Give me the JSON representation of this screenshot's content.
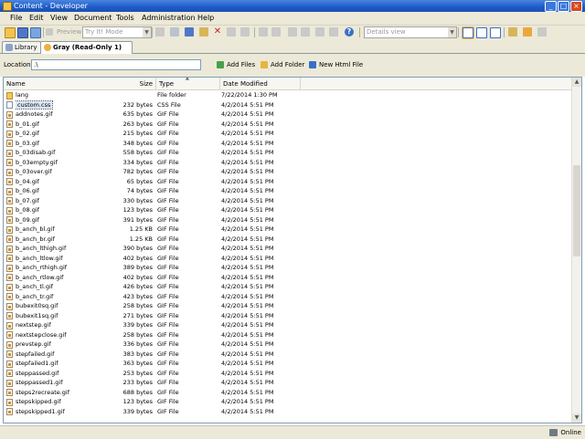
{
  "window": {
    "title": "Content - Developer"
  },
  "menu": [
    "File",
    "Edit",
    "View",
    "Document",
    "Tools",
    "Administration",
    "Help"
  ],
  "toolbar": {
    "preview_label": "Preview",
    "mode_select": "Try It! Mode",
    "view_select": "Details view"
  },
  "tabs": [
    {
      "label": "Library"
    },
    {
      "label": "Gray (Read-Only 1)"
    }
  ],
  "location": {
    "label": "Location:",
    "value": ".\\"
  },
  "actions": {
    "add_files": "Add Files",
    "add_folder": "Add Folder",
    "new_html": "New Html File"
  },
  "columns": {
    "name": "Name",
    "size": "Size",
    "type": "Type",
    "date": "Date Modified"
  },
  "files": [
    {
      "name": "lang",
      "size": "",
      "type": "File folder",
      "date": "7/22/2014 1:30 PM",
      "kind": "folder"
    },
    {
      "name": "custom.css",
      "size": "232 bytes",
      "type": "CSS File",
      "date": "4/2/2014 5:51 PM",
      "kind": "css"
    },
    {
      "name": "addnotes.gif",
      "size": "635 bytes",
      "type": "GIF File",
      "date": "4/2/2014 5:51 PM",
      "kind": "gif"
    },
    {
      "name": "b_01.gif",
      "size": "263 bytes",
      "type": "GIF File",
      "date": "4/2/2014 5:51 PM",
      "kind": "gif"
    },
    {
      "name": "b_02.gif",
      "size": "215 bytes",
      "type": "GIF File",
      "date": "4/2/2014 5:51 PM",
      "kind": "gif"
    },
    {
      "name": "b_03.gif",
      "size": "348 bytes",
      "type": "GIF File",
      "date": "4/2/2014 5:51 PM",
      "kind": "gif"
    },
    {
      "name": "b_03disab.gif",
      "size": "558 bytes",
      "type": "GIF File",
      "date": "4/2/2014 5:51 PM",
      "kind": "gif"
    },
    {
      "name": "b_03empty.gif",
      "size": "334 bytes",
      "type": "GIF File",
      "date": "4/2/2014 5:51 PM",
      "kind": "gif"
    },
    {
      "name": "b_03over.gif",
      "size": "782 bytes",
      "type": "GIF File",
      "date": "4/2/2014 5:51 PM",
      "kind": "gif"
    },
    {
      "name": "b_04.gif",
      "size": "65 bytes",
      "type": "GIF File",
      "date": "4/2/2014 5:51 PM",
      "kind": "gif"
    },
    {
      "name": "b_06.gif",
      "size": "74 bytes",
      "type": "GIF File",
      "date": "4/2/2014 5:51 PM",
      "kind": "gif"
    },
    {
      "name": "b_07.gif",
      "size": "330 bytes",
      "type": "GIF File",
      "date": "4/2/2014 5:51 PM",
      "kind": "gif"
    },
    {
      "name": "b_08.gif",
      "size": "123 bytes",
      "type": "GIF File",
      "date": "4/2/2014 5:51 PM",
      "kind": "gif"
    },
    {
      "name": "b_09.gif",
      "size": "391 bytes",
      "type": "GIF File",
      "date": "4/2/2014 5:51 PM",
      "kind": "gif"
    },
    {
      "name": "b_anch_bl.gif",
      "size": "1.25 KB",
      "type": "GIF File",
      "date": "4/2/2014 5:51 PM",
      "kind": "gif"
    },
    {
      "name": "b_anch_br.gif",
      "size": "1.25 KB",
      "type": "GIF File",
      "date": "4/2/2014 5:51 PM",
      "kind": "gif"
    },
    {
      "name": "b_anch_lthigh.gif",
      "size": "390 bytes",
      "type": "GIF File",
      "date": "4/2/2014 5:51 PM",
      "kind": "gif"
    },
    {
      "name": "b_anch_ltlow.gif",
      "size": "402 bytes",
      "type": "GIF File",
      "date": "4/2/2014 5:51 PM",
      "kind": "gif"
    },
    {
      "name": "b_anch_rthigh.gif",
      "size": "389 bytes",
      "type": "GIF File",
      "date": "4/2/2014 5:51 PM",
      "kind": "gif"
    },
    {
      "name": "b_anch_rtlow.gif",
      "size": "402 bytes",
      "type": "GIF File",
      "date": "4/2/2014 5:51 PM",
      "kind": "gif"
    },
    {
      "name": "b_anch_tl.gif",
      "size": "426 bytes",
      "type": "GIF File",
      "date": "4/2/2014 5:51 PM",
      "kind": "gif"
    },
    {
      "name": "b_anch_tr.gif",
      "size": "423 bytes",
      "type": "GIF File",
      "date": "4/2/2014 5:51 PM",
      "kind": "gif"
    },
    {
      "name": "bubexit0sq.gif",
      "size": "258 bytes",
      "type": "GIF File",
      "date": "4/2/2014 5:51 PM",
      "kind": "gif"
    },
    {
      "name": "bubexit1sq.gif",
      "size": "271 bytes",
      "type": "GIF File",
      "date": "4/2/2014 5:51 PM",
      "kind": "gif"
    },
    {
      "name": "nextstep.gif",
      "size": "339 bytes",
      "type": "GIF File",
      "date": "4/2/2014 5:51 PM",
      "kind": "gif"
    },
    {
      "name": "nextstepclose.gif",
      "size": "258 bytes",
      "type": "GIF File",
      "date": "4/2/2014 5:51 PM",
      "kind": "gif"
    },
    {
      "name": "prevstep.gif",
      "size": "336 bytes",
      "type": "GIF File",
      "date": "4/2/2014 5:51 PM",
      "kind": "gif"
    },
    {
      "name": "stepfailed.gif",
      "size": "383 bytes",
      "type": "GIF File",
      "date": "4/2/2014 5:51 PM",
      "kind": "gif"
    },
    {
      "name": "stepfailed1.gif",
      "size": "363 bytes",
      "type": "GIF File",
      "date": "4/2/2014 5:51 PM",
      "kind": "gif"
    },
    {
      "name": "steppassed.gif",
      "size": "253 bytes",
      "type": "GIF File",
      "date": "4/2/2014 5:51 PM",
      "kind": "gif"
    },
    {
      "name": "steppassed1.gif",
      "size": "233 bytes",
      "type": "GIF File",
      "date": "4/2/2014 5:51 PM",
      "kind": "gif"
    },
    {
      "name": "steps2recreate.gif",
      "size": "688 bytes",
      "type": "GIF File",
      "date": "4/2/2014 5:51 PM",
      "kind": "gif"
    },
    {
      "name": "stepskipped.gif",
      "size": "123 bytes",
      "type": "GIF File",
      "date": "4/2/2014 5:51 PM",
      "kind": "gif"
    },
    {
      "name": "stepskipped1.gif",
      "size": "339 bytes",
      "type": "GIF File",
      "date": "4/2/2014 5:51 PM",
      "kind": "gif"
    }
  ],
  "selected_row": 1,
  "status": {
    "text": "Online"
  },
  "colors": {
    "titlebar": "#1d5bc6",
    "chrome": "#ece9d8",
    "accent": "#7f9db9"
  }
}
